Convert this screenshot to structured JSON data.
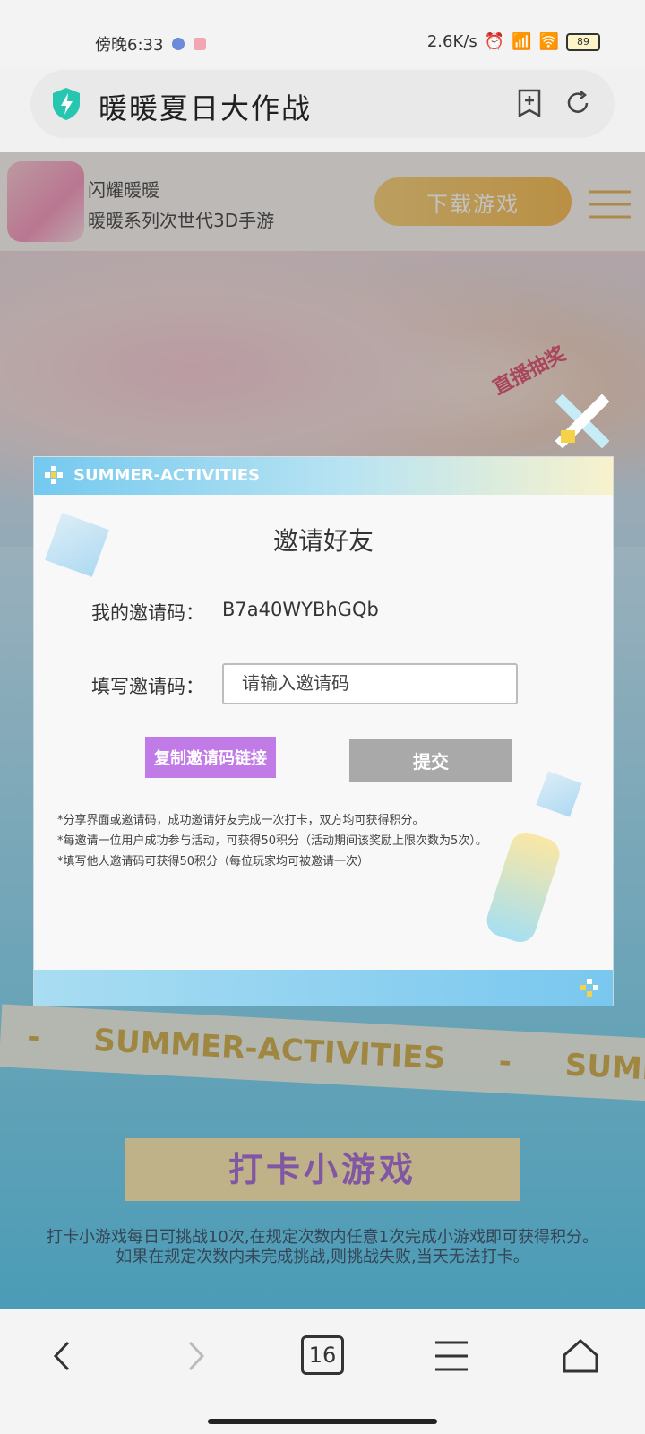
{
  "status_bar": {
    "time": "傍晚6:33",
    "network_speed": "2.6K/s",
    "battery": "89"
  },
  "browser": {
    "page_title": "暖暖夏日大作战",
    "tab_count": "16"
  },
  "web": {
    "app_name": "闪耀暖暖",
    "app_subtitle": "暖暖系列次世代3D手游",
    "download_label": "下载游戏",
    "live_badge": "直播抽奖",
    "marquee_text_1": "SUMMER-ACTIVITIES",
    "marquee_text_2": "SUMMER",
    "marquee_dash": "-",
    "section_title": "打卡小游戏",
    "game_desc_1": "打卡小游戏每日可挑战10次,在规定次数内任意1次完成小游戏即可获得积分。",
    "game_desc_2": "如果在规定次数内未完成挑战,则挑战失败,当天无法打卡。"
  },
  "modal": {
    "header_label": "SUMMER-ACTIVITIES",
    "title": "邀请好友",
    "my_code_label": "我的邀请码：",
    "my_code_value": "B7a40WYBhGQb",
    "fill_code_label": "填写邀请码：",
    "fill_code_placeholder": "请输入邀请码",
    "copy_button": "复制邀请码链接",
    "submit_button": "提交",
    "notes": [
      "*分享界面或邀请码，成功邀请好友完成一次打卡，双方均可获得积分。",
      "*每邀请一位用户成功参与活动，可获得50积分（活动期间该奖励上限次数为5次）。",
      "*填写他人邀请码可获得50积分（每位玩家均可被邀请一次）"
    ]
  },
  "colors": {
    "accent_purple": "#c07be6",
    "submit_gray": "#a9a9a9",
    "download_gold": "#f2b23e",
    "modal_blue": "#74c9ef"
  },
  "icons": {
    "shield": "shield-bolt-icon",
    "add_bookmark": "add-bookmark-icon",
    "refresh": "refresh-icon",
    "close": "close-x-icon",
    "back": "back-arrow-icon",
    "forward": "forward-arrow-icon",
    "menu": "menu-icon",
    "home": "home-icon"
  }
}
